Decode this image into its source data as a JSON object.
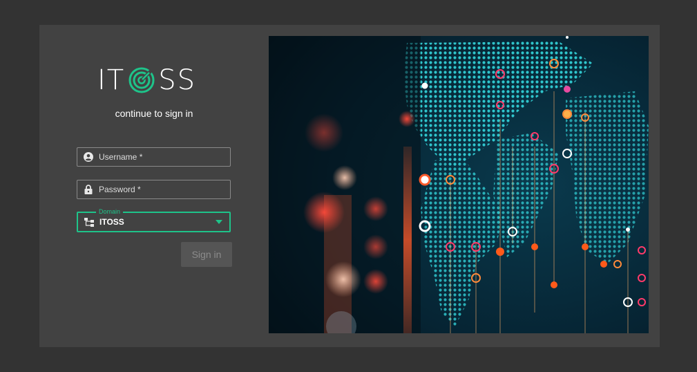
{
  "brand": {
    "name": "ITOSS",
    "letters_before": "IT",
    "letters_after": "SS",
    "accent_color": "#1ec48a"
  },
  "subtitle": "continue to sign in",
  "form": {
    "username_label": "Username *",
    "password_label": "Password *",
    "domain_label": "Domain",
    "domain_value": "ITOSS",
    "submit_label": "Sign in"
  },
  "icons": {
    "username": "account-circle-icon",
    "password": "lock-icon",
    "domain": "sitemap-icon",
    "dropdown": "caret-down-icon"
  },
  "hero": {
    "image": "world-map-illustration"
  }
}
